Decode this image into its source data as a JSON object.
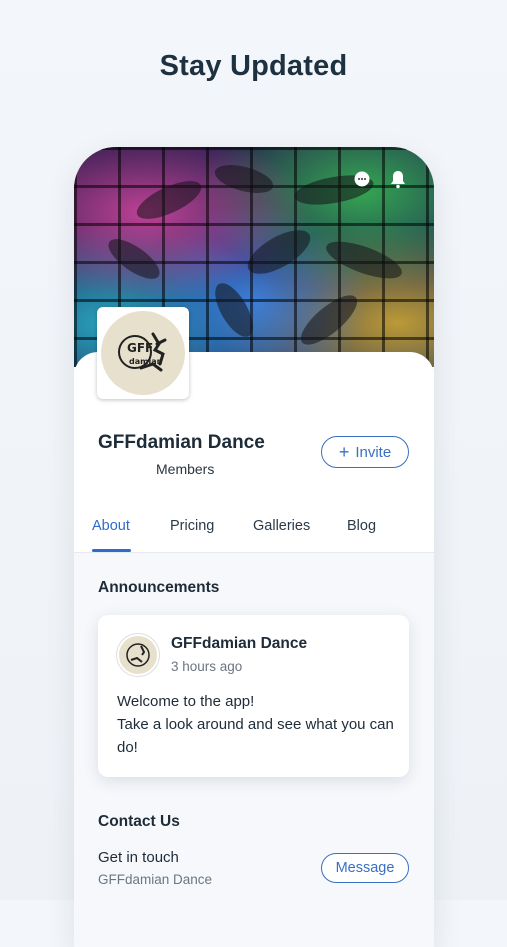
{
  "headline": "Stay Updated",
  "group": {
    "name": "GFFdamian Dance",
    "members_label": "Members",
    "logo_text_top": "GFF",
    "logo_text_bottom": "damian"
  },
  "actions": {
    "invite_icon": "+",
    "invite_label": "Invite",
    "message_label": "Message"
  },
  "tabs": [
    "About",
    "Pricing",
    "Galleries",
    "Blog"
  ],
  "active_tab": "About",
  "announcements": {
    "title": "Announcements",
    "post": {
      "author": "GFFdamian Dance",
      "time": "3 hours ago",
      "line1": "Welcome to the app!",
      "line2": "Take a look around and see what you can do!"
    }
  },
  "contact": {
    "title": "Contact Us",
    "subtitle": "Get in touch",
    "name": "GFFdamian Dance"
  },
  "icons": [
    "chat-icon",
    "bell-icon",
    "plus-icon"
  ],
  "colors": {
    "accent": "#3a6fc4",
    "headline": "#1e3140"
  }
}
